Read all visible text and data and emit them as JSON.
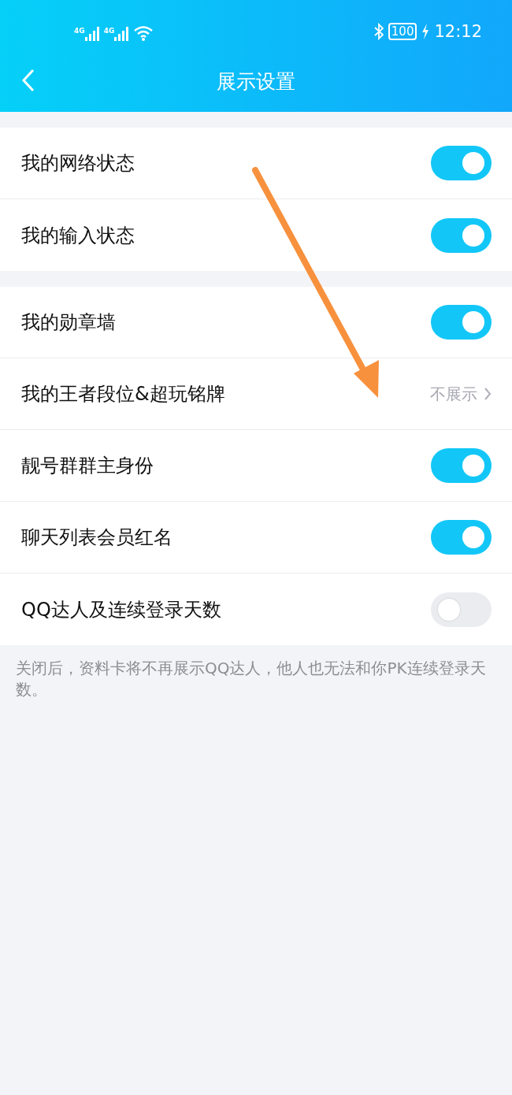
{
  "status_bar": {
    "signals": [
      {
        "label": "4G"
      },
      {
        "label": "4G"
      }
    ],
    "battery": "100",
    "time": "12:12"
  },
  "nav": {
    "title": "展示设置"
  },
  "groups": [
    {
      "rows": [
        {
          "kind": "toggle",
          "label": "我的网络状态",
          "on": true
        },
        {
          "kind": "toggle",
          "label": "我的输入状态",
          "on": true
        }
      ]
    },
    {
      "rows": [
        {
          "kind": "toggle",
          "label": "我的勋章墙",
          "on": true
        },
        {
          "kind": "link",
          "label": "我的王者段位&超玩铭牌",
          "value": "不展示"
        },
        {
          "kind": "toggle",
          "label": "靓号群群主身份",
          "on": true
        },
        {
          "kind": "toggle",
          "label": "聊天列表会员红名",
          "on": true
        },
        {
          "kind": "toggle",
          "label": "QQ达人及连续登录天数",
          "on": false
        }
      ]
    }
  ],
  "footer_note": "关闭后，资料卡将不再展示QQ达人，他人也无法和你PK连续登录天数。"
}
